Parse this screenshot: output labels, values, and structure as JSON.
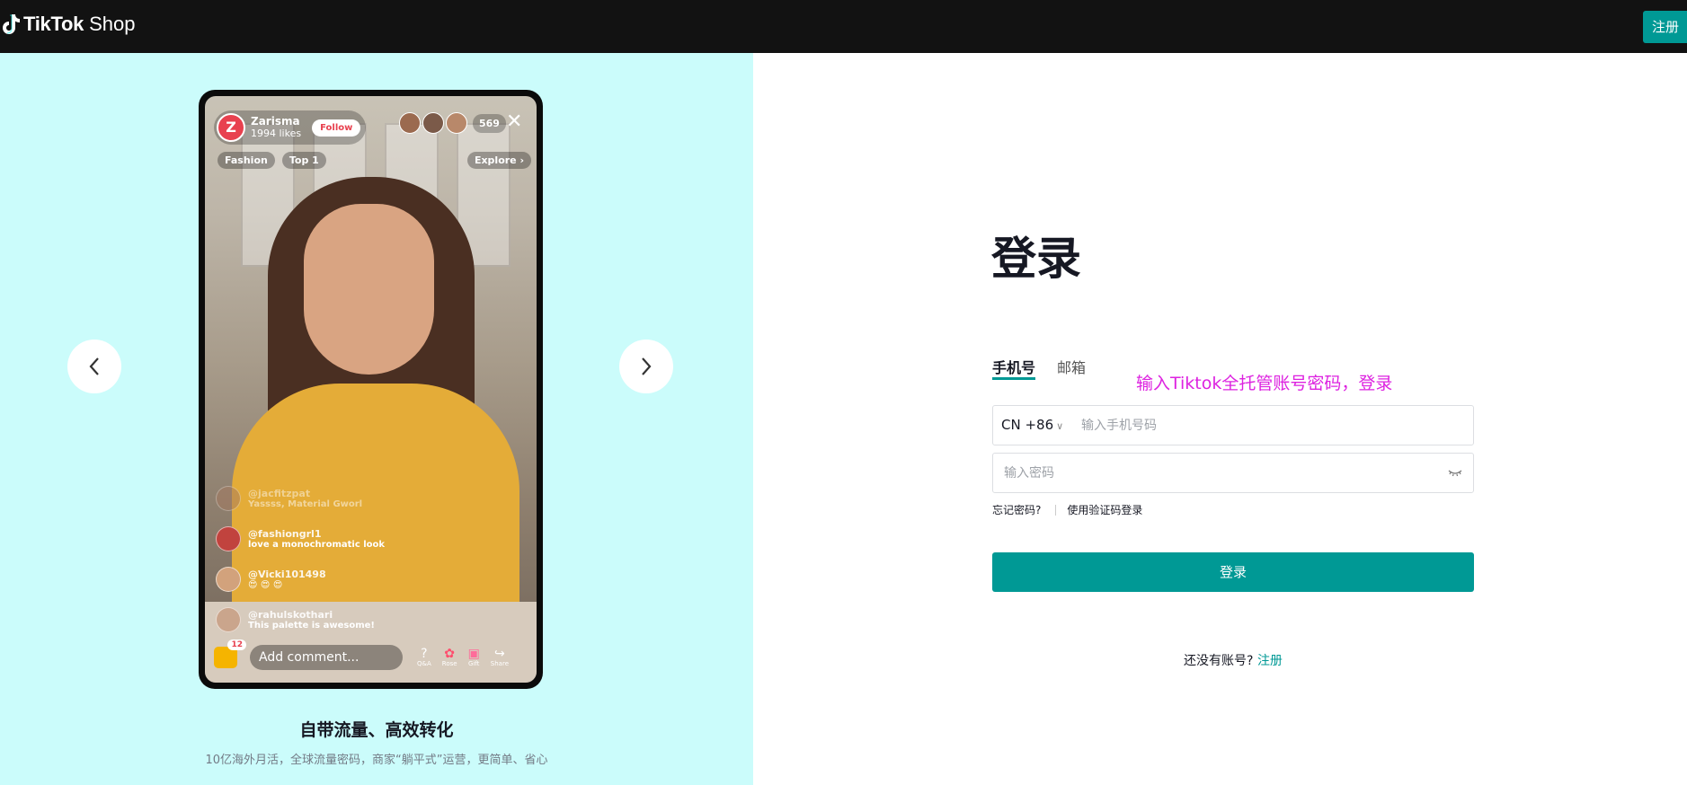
{
  "header": {
    "logo_text": "TikTok",
    "logo_sub": "Shop",
    "register_label": "注册"
  },
  "hero": {
    "live": {
      "host_name": "Zarisma",
      "host_initial": "Z",
      "likes_count": "1994",
      "likes_label": "likes",
      "follow_label": "Follow",
      "viewer_count": "569",
      "close_glyph": "✕",
      "tags": [
        "Fashion",
        "Top 1"
      ],
      "explore_label": "Explore ›",
      "comments": [
        {
          "user": "@jacfitzpat",
          "text": "Yassss, Material Gworl"
        },
        {
          "user": "@fashiongrl1",
          "text": "love a monochromatic look"
        },
        {
          "user": "@Vicki101498",
          "text": "😍 😍 😍"
        },
        {
          "user": "@rahulskothari",
          "text": "This palette is awesome!"
        }
      ],
      "bag_count": "12",
      "add_comment_placeholder": "Add comment...",
      "actions": [
        "Q&A",
        "Rose",
        "Gift",
        "Share"
      ]
    },
    "title": "自带流量、高效转化",
    "subtitle": "10亿海外月活，全球流量密码，商家“躺平式”运营，更简单、省心"
  },
  "login": {
    "title": "登录",
    "tabs": [
      "手机号",
      "邮箱"
    ],
    "annotation": "输入Tiktok全托管账号密码，登录",
    "country_code": "CN +86",
    "phone_placeholder": "输入手机号码",
    "password_placeholder": "输入密码",
    "forgot_password": "忘记密码?",
    "code_login": "使用验证码登录",
    "submit_label": "登录",
    "no_account_text": "还没有账号?",
    "signup_link": "注册"
  },
  "colors": {
    "accent": "#009995",
    "hero_bg": "#cbfcfb",
    "topbar_bg": "#121212",
    "annotation": "#dd22e0"
  }
}
